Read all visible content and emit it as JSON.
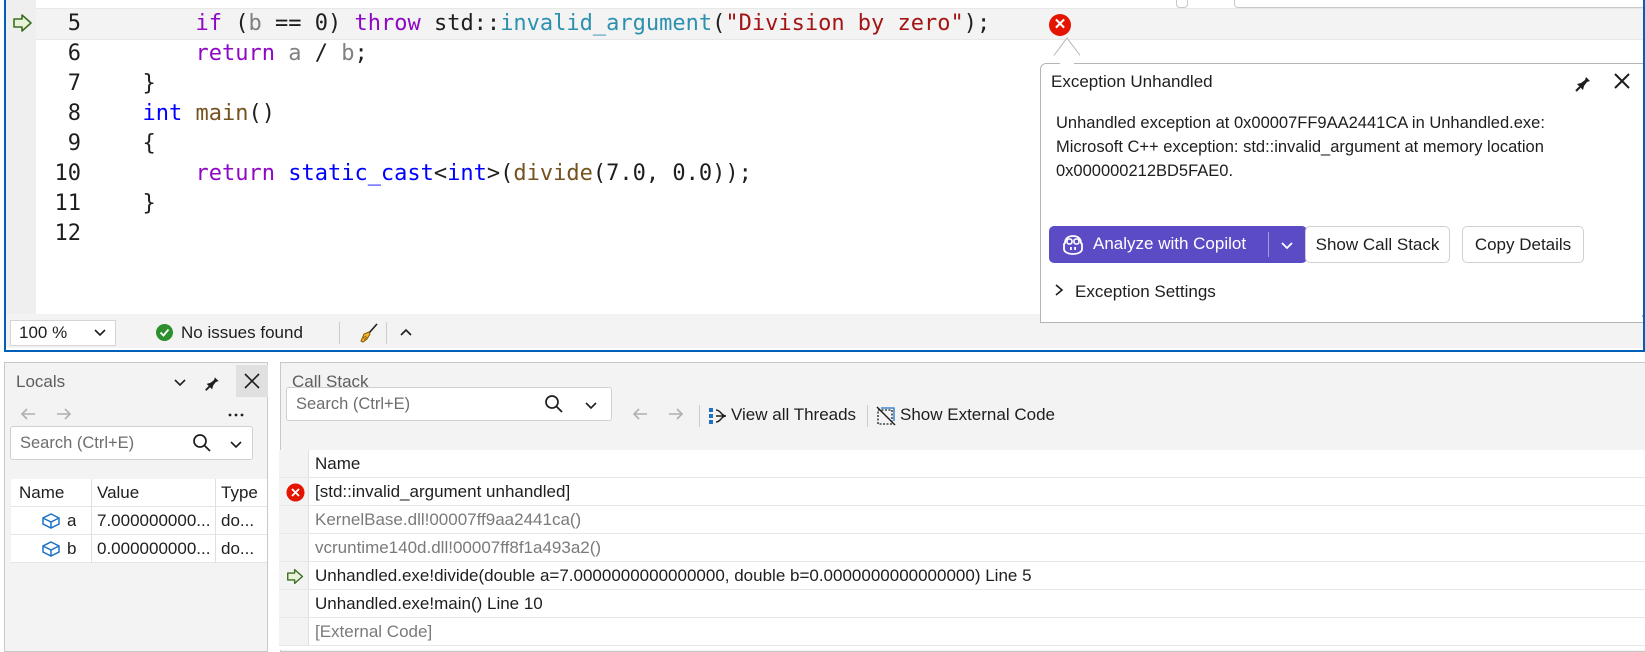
{
  "editor": {
    "lines": [
      {
        "num": "5",
        "tokens": [
          {
            "t": "    ",
            "c": ""
          },
          {
            "t": "if",
            "c": "kw"
          },
          {
            "t": " (",
            "c": ""
          },
          {
            "t": "b",
            "c": "par"
          },
          {
            "t": " == ",
            "c": ""
          },
          {
            "t": "0",
            "c": ""
          },
          {
            "t": ") ",
            "c": ""
          },
          {
            "t": "throw",
            "c": "kw"
          },
          {
            "t": " std::",
            "c": ""
          },
          {
            "t": "invalid_argument",
            "c": "cls"
          },
          {
            "t": "(",
            "c": ""
          },
          {
            "t": "\"Division by zero\"",
            "c": "str"
          },
          {
            "t": ");",
            "c": ""
          }
        ]
      },
      {
        "num": "6",
        "tokens": [
          {
            "t": "    ",
            "c": ""
          },
          {
            "t": "return",
            "c": "kw"
          },
          {
            "t": " ",
            "c": ""
          },
          {
            "t": "a",
            "c": "par"
          },
          {
            "t": " / ",
            "c": ""
          },
          {
            "t": "b",
            "c": "par"
          },
          {
            "t": ";",
            "c": ""
          }
        ]
      },
      {
        "num": "7",
        "tokens": [
          {
            "t": "}",
            "c": ""
          }
        ]
      },
      {
        "num": "8",
        "tokens": [
          {
            "t": "int",
            "c": "ty"
          },
          {
            "t": " ",
            "c": ""
          },
          {
            "t": "main",
            "c": "fn"
          },
          {
            "t": "()",
            "c": ""
          }
        ]
      },
      {
        "num": "9",
        "tokens": [
          {
            "t": "{",
            "c": ""
          }
        ]
      },
      {
        "num": "10",
        "tokens": [
          {
            "t": "    ",
            "c": ""
          },
          {
            "t": "return",
            "c": "kw"
          },
          {
            "t": " ",
            "c": ""
          },
          {
            "t": "static_cast",
            "c": "ty"
          },
          {
            "t": "<",
            "c": ""
          },
          {
            "t": "int",
            "c": "ty"
          },
          {
            "t": ">(",
            "c": ""
          },
          {
            "t": "divide",
            "c": "fn"
          },
          {
            "t": "(7.0, 0.0));",
            "c": ""
          }
        ]
      },
      {
        "num": "11",
        "tokens": [
          {
            "t": "}",
            "c": ""
          }
        ]
      },
      {
        "num": "12",
        "tokens": []
      }
    ]
  },
  "exception": {
    "title": "Exception Unhandled",
    "message": "Unhandled exception at 0x00007FF9AA2441CA in Unhandled.exe: Microsoft C++ exception: std::invalid_argument at memory location 0x000000212BD5FAE0.",
    "analyze_label": "Analyze with Copilot",
    "call_stack_label": "Show Call Stack",
    "copy_label": "Copy Details",
    "settings_label": "Exception Settings"
  },
  "statusbar": {
    "zoom": "100 %",
    "issues": "No issues found"
  },
  "locals": {
    "title": "Locals",
    "search_placeholder": "Search (Ctrl+E)",
    "columns": [
      "Name",
      "Value",
      "Type"
    ],
    "rows": [
      {
        "name": "a",
        "value": "7.000000000...",
        "type": "do..."
      },
      {
        "name": "b",
        "value": "0.000000000...",
        "type": "do..."
      }
    ]
  },
  "callstack": {
    "title": "Call Stack",
    "search_placeholder": "Search (Ctrl+E)",
    "view_threads": "View all Threads",
    "show_external": "Show External Code",
    "column": "Name",
    "rows": [
      {
        "icon": "error",
        "text": "[std::invalid_argument unhandled]",
        "dim": false
      },
      {
        "icon": "",
        "text": "KernelBase.dll!00007ff9aa2441ca()",
        "dim": true
      },
      {
        "icon": "",
        "text": "vcruntime140d.dll!00007ff8f1a493a2()",
        "dim": true
      },
      {
        "icon": "current",
        "text": "Unhandled.exe!divide(double a=7.0000000000000000, double b=0.0000000000000000) Line 5",
        "dim": false
      },
      {
        "icon": "",
        "text": "Unhandled.exe!main() Line 10",
        "dim": false
      },
      {
        "icon": "",
        "text": "[External Code]",
        "dim": true
      }
    ]
  },
  "colors": {
    "accent": "#005fb8",
    "copilot_button": "#5b4bc4",
    "error": "#e51400",
    "success": "#2d8f2d"
  }
}
